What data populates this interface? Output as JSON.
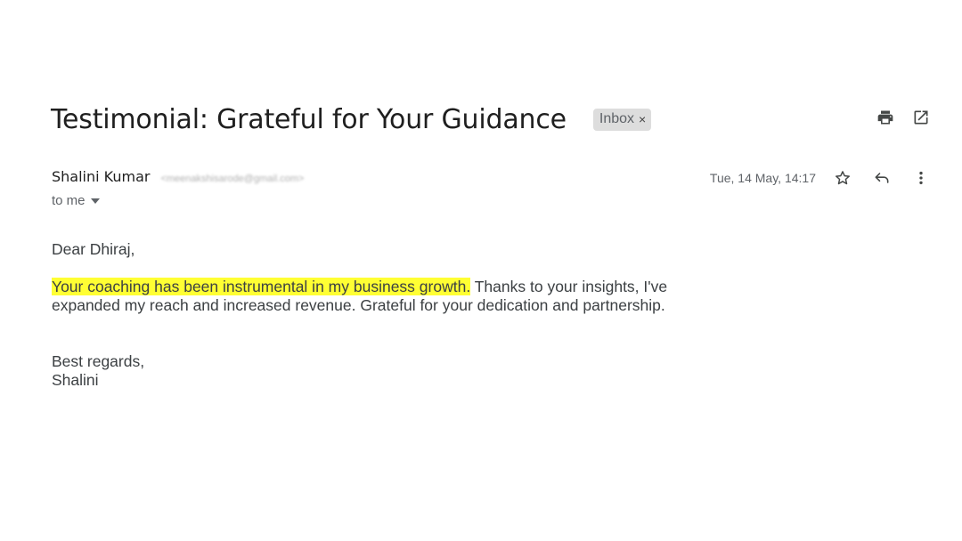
{
  "email": {
    "subject": "Testimonial: Grateful for Your Guidance",
    "label": "Inbox",
    "label_remove": "×",
    "sender": {
      "name": "Shalini Kumar",
      "email": "<meenakshisarode@gmail.com>"
    },
    "recipient": "to me",
    "date": "Tue, 14 May, 14:17",
    "body": {
      "greeting": "Dear Dhiraj,",
      "highlighted": "Your coaching has been instrumental in my business growth.",
      "rest": " Thanks to your insights, I've expanded my reach and increased revenue. Grateful for your dedication and partnership.",
      "closing": "Best regards,",
      "signature": "Shalini"
    }
  },
  "icons": {
    "print": "printer-icon",
    "open_new_window": "open-in-new-icon",
    "star": "star-icon",
    "reply": "reply-icon",
    "more": "more-vert-icon"
  },
  "colors": {
    "highlight": "#ffff33",
    "label_chip": "#dddddd",
    "text": "#202124",
    "muted": "#5f6368"
  }
}
